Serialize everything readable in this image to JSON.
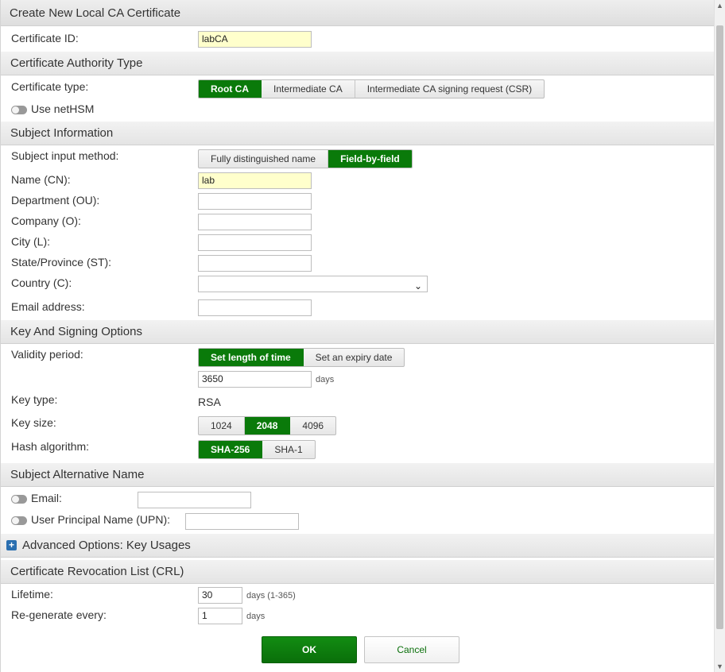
{
  "title": "Create New Local CA Certificate",
  "certificate_id": {
    "label": "Certificate ID:",
    "value": "labCA"
  },
  "ca_type": {
    "header": "Certificate Authority Type",
    "label": "Certificate type:",
    "options": [
      "Root CA",
      "Intermediate CA",
      "Intermediate CA signing request (CSR)"
    ],
    "selected": "Root CA",
    "use_nethsm": "Use netHSM"
  },
  "subject": {
    "header": "Subject Information",
    "input_method_label": "Subject input method:",
    "input_methods": [
      "Fully distinguished name",
      "Field-by-field"
    ],
    "selected_method": "Field-by-field",
    "name_label": "Name (CN):",
    "name_value": "lab",
    "department_label": "Department (OU):",
    "department_value": "",
    "company_label": "Company (O):",
    "company_value": "",
    "city_label": "City (L):",
    "city_value": "",
    "state_label": "State/Province (ST):",
    "state_value": "",
    "country_label": "Country (C):",
    "country_value": "",
    "email_label": "Email address:",
    "email_value": ""
  },
  "key_options": {
    "header": "Key And Signing Options",
    "validity_label": "Validity period:",
    "validity_options": [
      "Set length of time",
      "Set an expiry date"
    ],
    "validity_selected": "Set length of time",
    "validity_value": "3650",
    "validity_unit": "days",
    "key_type_label": "Key type:",
    "key_type_value": "RSA",
    "key_size_label": "Key size:",
    "key_sizes": [
      "1024",
      "2048",
      "4096"
    ],
    "key_size_selected": "2048",
    "hash_label": "Hash algorithm:",
    "hash_options": [
      "SHA-256",
      "SHA-1"
    ],
    "hash_selected": "SHA-256"
  },
  "san": {
    "header": "Subject Alternative Name",
    "email_label": "Email:",
    "email_value": "",
    "upn_label": "User Principal Name (UPN):",
    "upn_value": ""
  },
  "advanced": {
    "header": "Advanced Options: Key Usages"
  },
  "crl": {
    "header": "Certificate Revocation List (CRL)",
    "lifetime_label": "Lifetime:",
    "lifetime_value": "30",
    "lifetime_unit": "days (1-365)",
    "regen_label": "Re-generate every:",
    "regen_value": "1",
    "regen_unit": "days"
  },
  "footer": {
    "ok": "OK",
    "cancel": "Cancel"
  },
  "colors": {
    "accent": "#0a7a0a",
    "required_bg": "#ffffcc",
    "header_bg": "#e8e8e8"
  }
}
